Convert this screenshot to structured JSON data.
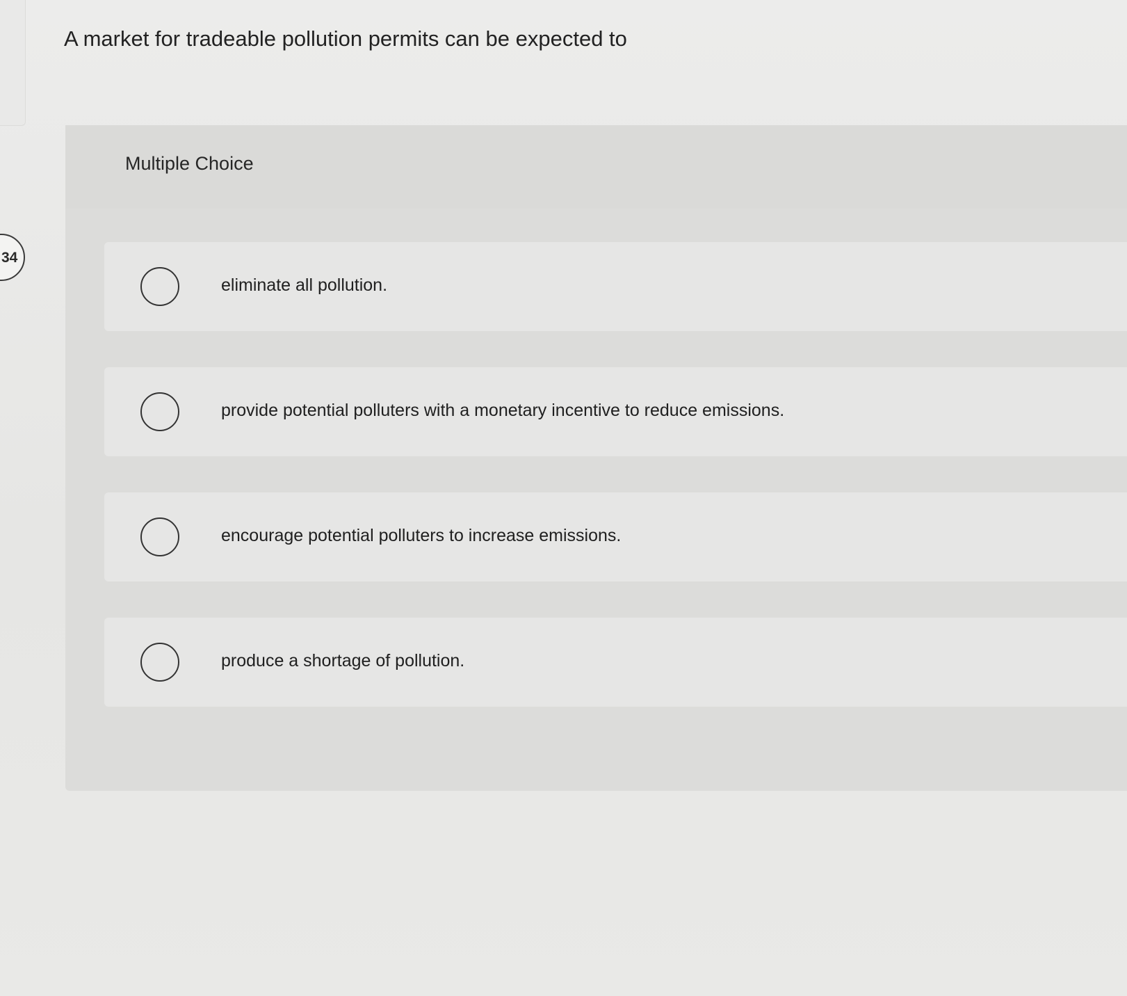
{
  "question": {
    "number": "34",
    "text": "A market for tradeable pollution permits can be expected to"
  },
  "mc": {
    "title": "Multiple Choice",
    "options": [
      {
        "label": "eliminate all pollution."
      },
      {
        "label": "provide potential polluters with a monetary incentive to reduce emissions."
      },
      {
        "label": "encourage potential polluters to increase emissions."
      },
      {
        "label": "produce a shortage of pollution."
      }
    ]
  }
}
